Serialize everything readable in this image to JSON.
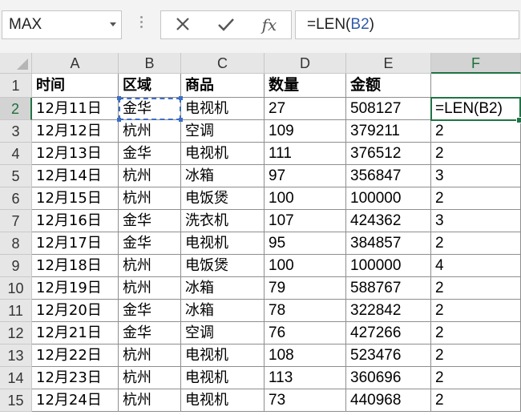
{
  "name_box": {
    "value": "MAX"
  },
  "formula_bar": {
    "cancel_icon": "close-icon",
    "enter_icon": "check-icon",
    "fx_label": "fx",
    "formula_prefix": "=LEN(",
    "formula_ref": "B2",
    "formula_suffix": ")"
  },
  "columns": [
    "A",
    "B",
    "C",
    "D",
    "E",
    "F"
  ],
  "active_column": "F",
  "active_row": 2,
  "colors": {
    "selection": "#217346",
    "reference": "#3c6fc4"
  },
  "header_row": {
    "row": "1",
    "cells": [
      "时间",
      "区域",
      "商品",
      "数量",
      "金额",
      ""
    ]
  },
  "rows": [
    {
      "row": "2",
      "cells": [
        "12月11日",
        "金华",
        "电视机",
        "27",
        "508127",
        "=LEN(B2)"
      ]
    },
    {
      "row": "3",
      "cells": [
        "12月12日",
        "杭州",
        "空调",
        "109",
        "379211",
        "2"
      ]
    },
    {
      "row": "4",
      "cells": [
        "12月13日",
        "金华",
        "电视机",
        "111",
        "376512",
        "2"
      ]
    },
    {
      "row": "5",
      "cells": [
        "12月14日",
        "杭州",
        "冰箱",
        "97",
        "356847",
        "3"
      ]
    },
    {
      "row": "6",
      "cells": [
        "12月15日",
        "杭州",
        "电饭煲",
        "100",
        "100000",
        "2"
      ]
    },
    {
      "row": "7",
      "cells": [
        "12月16日",
        "金华",
        "洗衣机",
        "107",
        "424362",
        "3"
      ]
    },
    {
      "row": "8",
      "cells": [
        "12月17日",
        "金华",
        "电视机",
        "95",
        "384857",
        "2"
      ]
    },
    {
      "row": "9",
      "cells": [
        "12月18日",
        "杭州",
        "电饭煲",
        "100",
        "100000",
        "4"
      ]
    },
    {
      "row": "10",
      "cells": [
        "12月19日",
        "杭州",
        "冰箱",
        "79",
        "588767",
        "2"
      ]
    },
    {
      "row": "11",
      "cells": [
        "12月20日",
        "金华",
        "冰箱",
        "78",
        "322842",
        "2"
      ]
    },
    {
      "row": "12",
      "cells": [
        "12月21日",
        "金华",
        "空调",
        "76",
        "427266",
        "2"
      ]
    },
    {
      "row": "13",
      "cells": [
        "12月22日",
        "杭州",
        "电视机",
        "108",
        "523476",
        "2"
      ]
    },
    {
      "row": "14",
      "cells": [
        "12月23日",
        "杭州",
        "电视机",
        "113",
        "360696",
        "2"
      ]
    },
    {
      "row": "15",
      "cells": [
        "12月24日",
        "杭州",
        "电视机",
        "73",
        "440968",
        "2"
      ]
    }
  ]
}
